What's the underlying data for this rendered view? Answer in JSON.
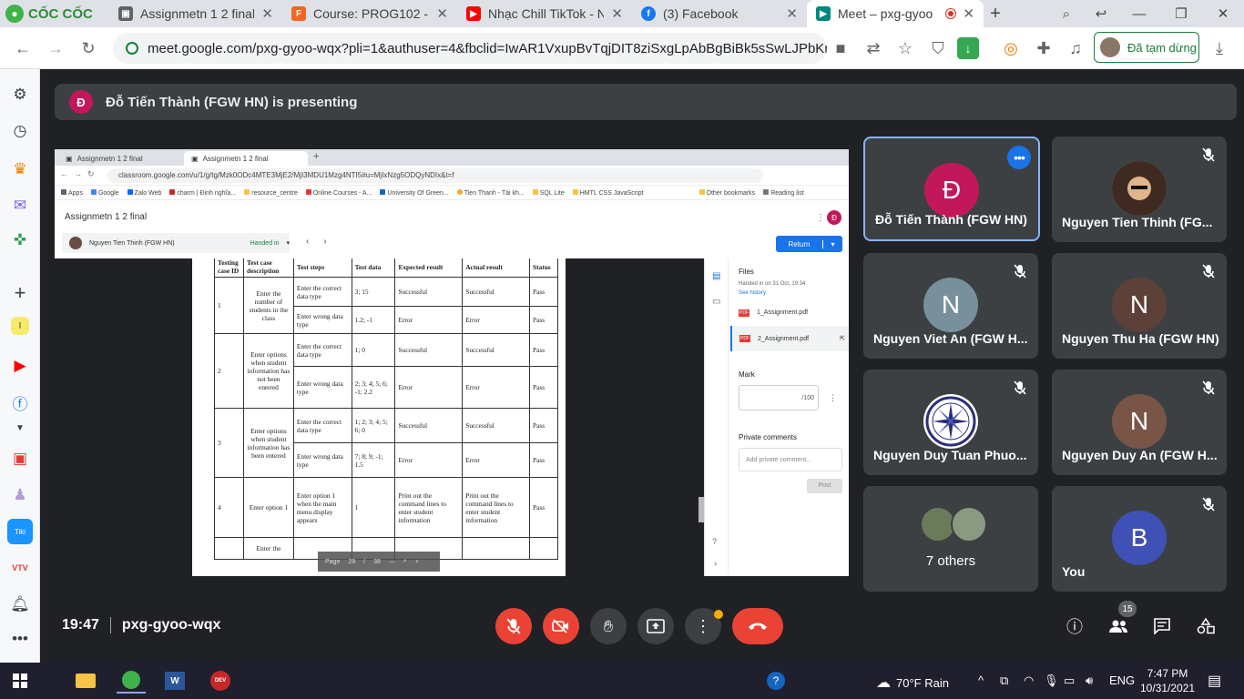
{
  "browser": {
    "logo_text": "CỐC CỐC",
    "tabs": [
      {
        "title": "Assignmetn 1 2 final",
        "icon": "classroom-icon",
        "color": "#5f6368"
      },
      {
        "title": "Course: PROG102 - G",
        "icon": "fpt-icon",
        "color": "#f26522"
      },
      {
        "title": "Nhạc Chill TikTok - Nh",
        "icon": "youtube-icon",
        "color": "#ff0000"
      },
      {
        "title": "(3) Facebook",
        "icon": "facebook-icon",
        "color": "#1877f2"
      },
      {
        "title": "Meet – pxg-gyoo",
        "icon": "meet-icon",
        "color": "#00897b"
      }
    ],
    "url": "meet.google.com/pxg-gyoo-wqx?pli=1&authuser=4&fbclid=IwAR1VxupBvTqjDIT8ziSxgLpAbBgBiBk5sSwLJPbKnuHqe7...",
    "profile_status": "Đã tạm dừng"
  },
  "meet": {
    "presenting_initial": "Đ",
    "presenting_text": "Đỗ Tiến Thành (FGW HN) is presenting",
    "time": "19:47",
    "meeting_code": "pxg-gyoo-wqx",
    "people_count": "15"
  },
  "presentation": {
    "tabs": [
      "Assignmetn 1 2 final",
      "Assignmetn 1 2 final"
    ],
    "url": "classroom.google.com/u/1/g/tg/Mzk0ODc4MTE3MjE2/MjI3MDU1Mzg4NTI5#u=MjIxNzg5ODQyNDIx&t=f",
    "bookmarks": [
      "Apps",
      "Google",
      "Zalo Web",
      "charm | Định nghĩa...",
      "resource_centre",
      "Online Courses - A...",
      "University Of Green...",
      "Tien Thanh - Tài kh...",
      "SQL Lite",
      "HMTL CSS JavaScript",
      "Other bookmarks",
      "Reading list"
    ],
    "doc_title": "Assignmetn 1 2 final",
    "student": "Nguyen Tien Thinh (FGW HN)",
    "status": "Handed in",
    "return_label": "Return",
    "avatar_initial": "Đ",
    "table_headers": [
      "Testing case ID",
      "Test case description",
      "Test steps",
      "Test data",
      "Expected result",
      "Actual result",
      "Status"
    ],
    "rows": [
      {
        "id": "1",
        "desc": "Enter the number of students in the class",
        "steps": [
          {
            "step": "Enter the correct data type",
            "data": "3; 15",
            "expected": "Successful",
            "actual": "Successful",
            "status": "Pass"
          },
          {
            "step": "Enter wrong data type",
            "data": "1.2; -1",
            "expected": "Error",
            "actual": "Error",
            "status": "Pass"
          }
        ]
      },
      {
        "id": "2",
        "desc": "Enter options when student information has not been entered",
        "steps": [
          {
            "step": "Enter the correct data type",
            "data": "1; 0",
            "expected": "Successful",
            "actual": "Successful",
            "status": "Pass"
          },
          {
            "step": "Enter wrong data type",
            "data": "2; 3; 4; 5; 6; -1; 2.2",
            "expected": "Error",
            "actual": "Error",
            "status": "Pass"
          }
        ]
      },
      {
        "id": "3",
        "desc": "Enter options when student information has been entered",
        "steps": [
          {
            "step": "Enter the correct data type",
            "data": "1; 2; 3; 4; 5; 6; 0",
            "expected": "Successful",
            "actual": "Successful",
            "status": "Pass"
          },
          {
            "step": "Enter wrong data type",
            "data": "7; 8; 9; -1; 1.5",
            "expected": "Error",
            "actual": "Error",
            "status": "Pass"
          }
        ]
      },
      {
        "id": "4",
        "desc": "Enter option 1",
        "steps": [
          {
            "step": "Enter option 1 when the main menu display appears",
            "data": "1",
            "expected": "Print out the command lines to enter student information",
            "actual": "Print out the command lines to enter student information",
            "status": "Pass"
          }
        ]
      }
    ],
    "next_row_desc": "Enter the",
    "pager": {
      "label": "Page",
      "current": "29",
      "sep": "/",
      "total": "38"
    },
    "files_title": "Files",
    "handed_in": "Handed in on 31 Oct, 19:34",
    "see_history": "See history",
    "files": [
      "1_Assignment.pdf",
      "2_Assignment.pdf"
    ],
    "mark_label": "Mark",
    "mark_max": "/100",
    "private_comments": "Private comments",
    "comment_placeholder": "Add private comment...",
    "post_label": "Post"
  },
  "participants": [
    {
      "name": "Đỗ Tiến Thành (FGW HN)",
      "initial": "Đ",
      "color": "#c2185b",
      "active": true,
      "icon": "more-options-icon"
    },
    {
      "name": "Nguyen Tien Thinh (FG...",
      "initial": "",
      "color": "#c9a06b",
      "icon": "mic-off-icon"
    },
    {
      "name": "Nguyen Viet An (FGW H...",
      "initial": "N",
      "color": "#78909c",
      "icon": "mic-off-icon"
    },
    {
      "name": "Nguyen Thu Ha (FGW HN)",
      "initial": "N",
      "color": "#5d4037",
      "icon": "mic-off-icon"
    },
    {
      "name": "Nguyen Duy Tuan Phuo...",
      "initial": "",
      "color": "#ffffff",
      "icon": "mic-off-icon"
    },
    {
      "name": "Nguyen Duy An (FGW H...",
      "initial": "N",
      "color": "#795548",
      "icon": "mic-off-icon"
    },
    {
      "name": "7 others",
      "initial": "",
      "color": "#3c4043"
    },
    {
      "name": "You",
      "initial": "B",
      "color": "#3f51b5",
      "icon": "mic-off-icon"
    }
  ],
  "taskbar": {
    "weather": "70°F  Rain",
    "lang": "ENG",
    "time": "7:47 PM",
    "date": "10/31/2021"
  }
}
